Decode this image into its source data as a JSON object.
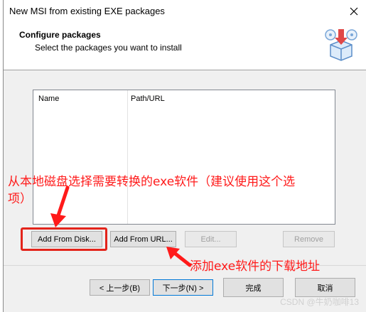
{
  "window": {
    "title": "New MSI from existing EXE packages"
  },
  "header": {
    "title": "Configure packages",
    "subtitle": "Select the packages you want to install",
    "icon": "install-package-icon"
  },
  "list": {
    "columns": [
      "Name",
      "Path/URL"
    ]
  },
  "buttons": {
    "add_from_disk": "Add From Disk...",
    "add_from_url": "Add From URL...",
    "edit": "Edit...",
    "remove": "Remove"
  },
  "wizard": {
    "back": "< 上一步(B)",
    "next": "下一步(N) >",
    "finish": "完成",
    "cancel": "取消"
  },
  "annotations": {
    "disk_note_line1": "从本地磁盘选择需要转换的exe软件（建议使用这个选",
    "disk_note_line2": "项）",
    "url_note": "添加exe软件的下载地址"
  },
  "watermark": "CSDN @牛奶咖啡13",
  "colors": {
    "annotation_red": "#ff1a1a",
    "highlight_border": "#e3241b",
    "default_button_border": "#0078d7"
  }
}
